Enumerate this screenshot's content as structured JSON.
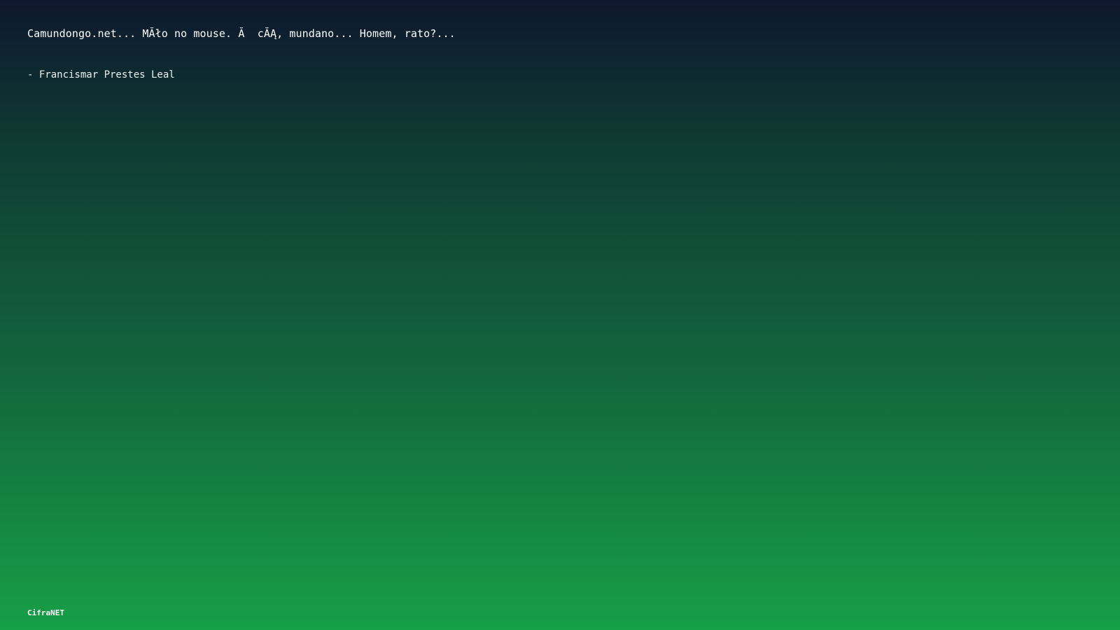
{
  "quote": {
    "text": "Camundongo.net... MĂło no mouse. Ă  cĂĄ, mundano... Homem, rato?..."
  },
  "author": {
    "text": "- Francismar Prestes Leal"
  },
  "footer": {
    "brand": "CifraNET"
  },
  "colors": {
    "gradient_top": "#0e172e",
    "gradient_mid": "#13673d",
    "gradient_bottom": "#169f46",
    "text": "#ffffff"
  }
}
